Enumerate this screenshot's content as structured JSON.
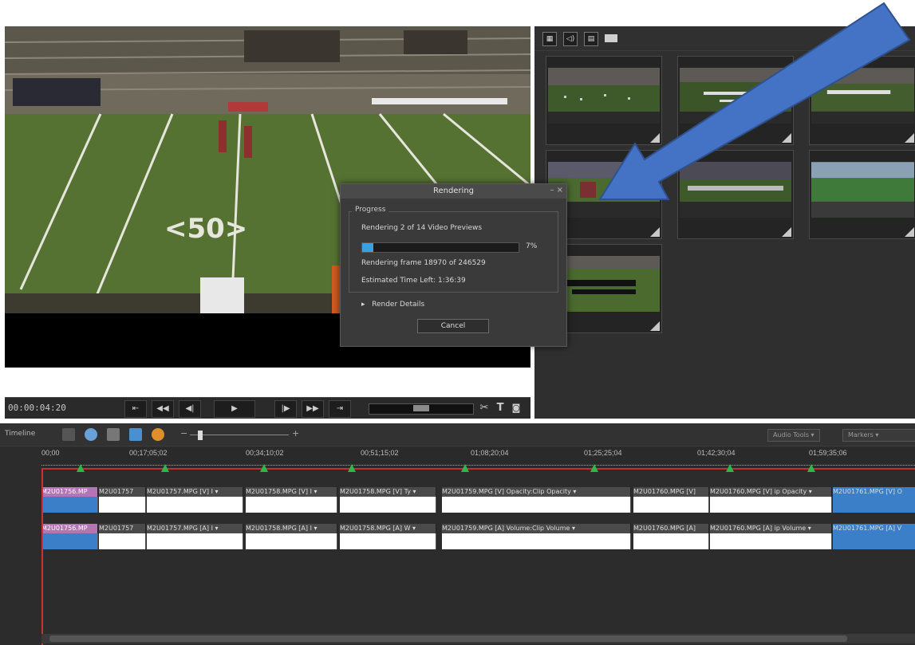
{
  "colors": {
    "accent_blue": "#3a7fc8",
    "progress_fill": "#3aa0e0",
    "marker_green": "#2fb84a",
    "playhead_red": "#d03030",
    "clip_magenta": "#b574b5"
  },
  "transport": {
    "timecode": "00:00:04:20",
    "buttons": [
      "⇤",
      "◀◀",
      "◀|",
      "▶",
      "|▶",
      "▶▶",
      "⇥"
    ],
    "tool_icons": [
      "scissors-icon",
      "text-icon",
      "camera-icon"
    ]
  },
  "thumbs": {
    "toolbar_icons": [
      "grid-icon",
      "audio-icon",
      "document-icon",
      "panel-icon"
    ]
  },
  "dialog": {
    "title": "Rendering",
    "group_label": "Progress",
    "status": "Rendering 2 of 14 Video Previews",
    "progress_percent": 7,
    "progress_label": "7%",
    "frame_text": "Rendering frame 18970 of 246529",
    "time_left": "Estimated Time Left:   1:36:39",
    "details_label": "Render Details",
    "cancel_label": "Cancel"
  },
  "timeline": {
    "panel_label": "Timeline",
    "audio_tools_label": "Audio Tools",
    "markers_label": "Markers",
    "timecodes": [
      "00;00",
      "00;17;05;02",
      "00;34;10;02",
      "00;51;15;02",
      "01;08;20;04",
      "01;25;25;04",
      "01;42;30;04",
      "01;59;35;06"
    ],
    "video_clips": [
      "M2U01756.MP",
      "M2U01757",
      "M2U01757.MPG [V] I ▾",
      "M2U01758.MPG [V] I ▾",
      "M2U01758.MPG [V] Ty ▾",
      "M2U01759.MPG [V] Opacity:Clip Opacity ▾",
      "M2U01760.MPG [V]",
      "M2U01760.MPG [V] ip Opacity ▾",
      "M2U01761.MPG [V] O"
    ],
    "audio_clips": [
      "M2U01756.MP",
      "M2U01757",
      "M2U01757.MPG [A] I ▾",
      "M2U01758.MPG [A] I ▾",
      "M2U01758.MPG [A] W ▾",
      "M2U01759.MPG [A] Volume:Clip Volume ▾",
      "M2U01760.MPG [A]",
      "M2U01760.MPG [A] ip Volume ▾",
      "M2U01761.MPG [A] V"
    ]
  }
}
